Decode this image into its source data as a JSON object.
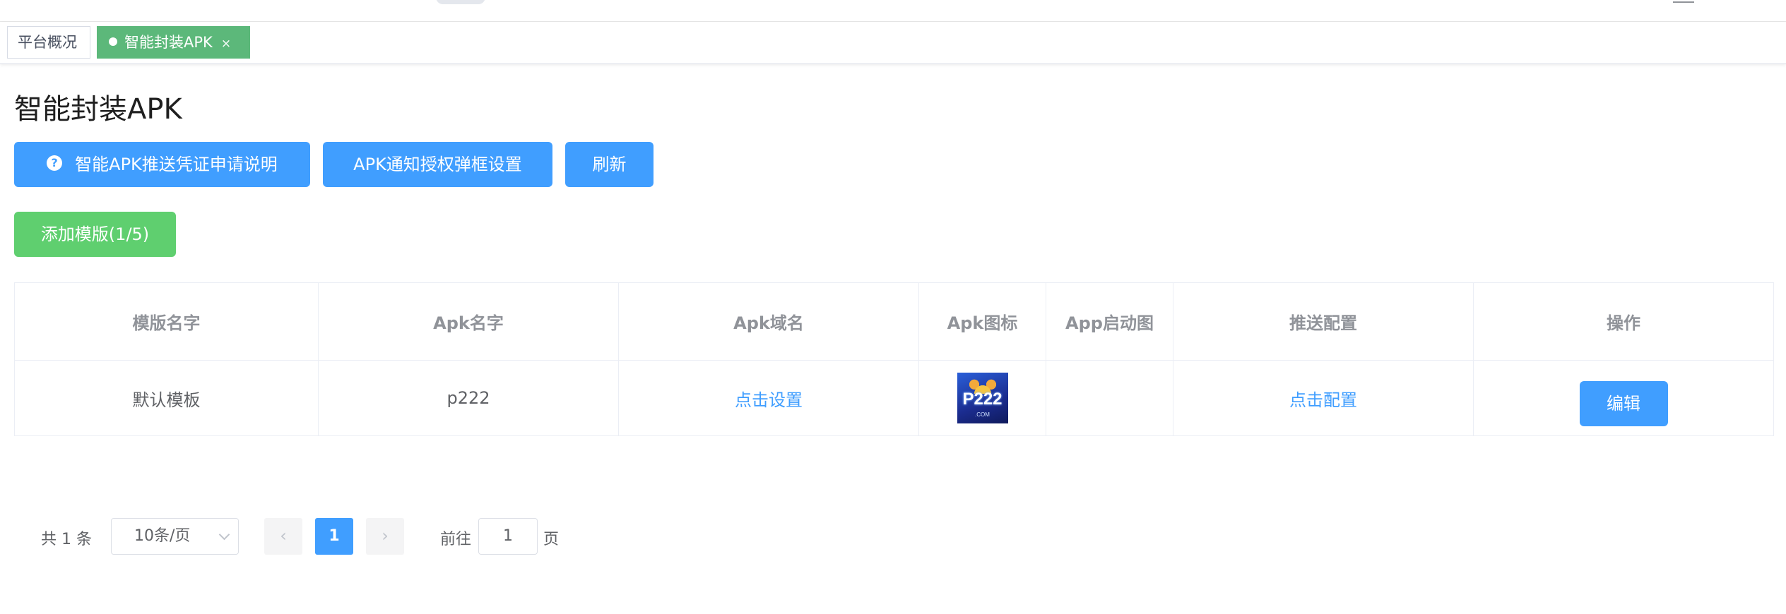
{
  "tags": {
    "home_label": "平台概况",
    "active_label": "智能封装APK",
    "close_glyph": "×"
  },
  "page": {
    "title": "智能封装APK"
  },
  "toolbar": {
    "help_icon": "?",
    "help_label": "智能APK推送凭证申请说明",
    "notify_label": "APK通知授权弹框设置",
    "refresh_label": "刷新",
    "add_label": "添加模版(1/5)"
  },
  "table": {
    "columns": [
      "模版名字",
      "Apk名字",
      "Apk域名",
      "Apk图标",
      "App启动图",
      "推送配置",
      "操作"
    ],
    "rows": [
      {
        "template_name": "默认模板",
        "apk_name": "p222",
        "domain_link": "点击设置",
        "icon_text": "P222",
        "icon_sub": ".COM",
        "splash": "",
        "push_link": "点击配置",
        "edit_label": "编辑"
      }
    ]
  },
  "pagination": {
    "total_label": "共 1 条",
    "page_size": "10条/页",
    "prev_glyph": "‹",
    "next_glyph": "›",
    "current_page": "1",
    "goto_prefix": "前往",
    "goto_value": "1",
    "goto_suffix": "页"
  },
  "colors": {
    "primary": "#409eff",
    "success": "#5fcf6f",
    "tag_active": "#5cb87a"
  }
}
